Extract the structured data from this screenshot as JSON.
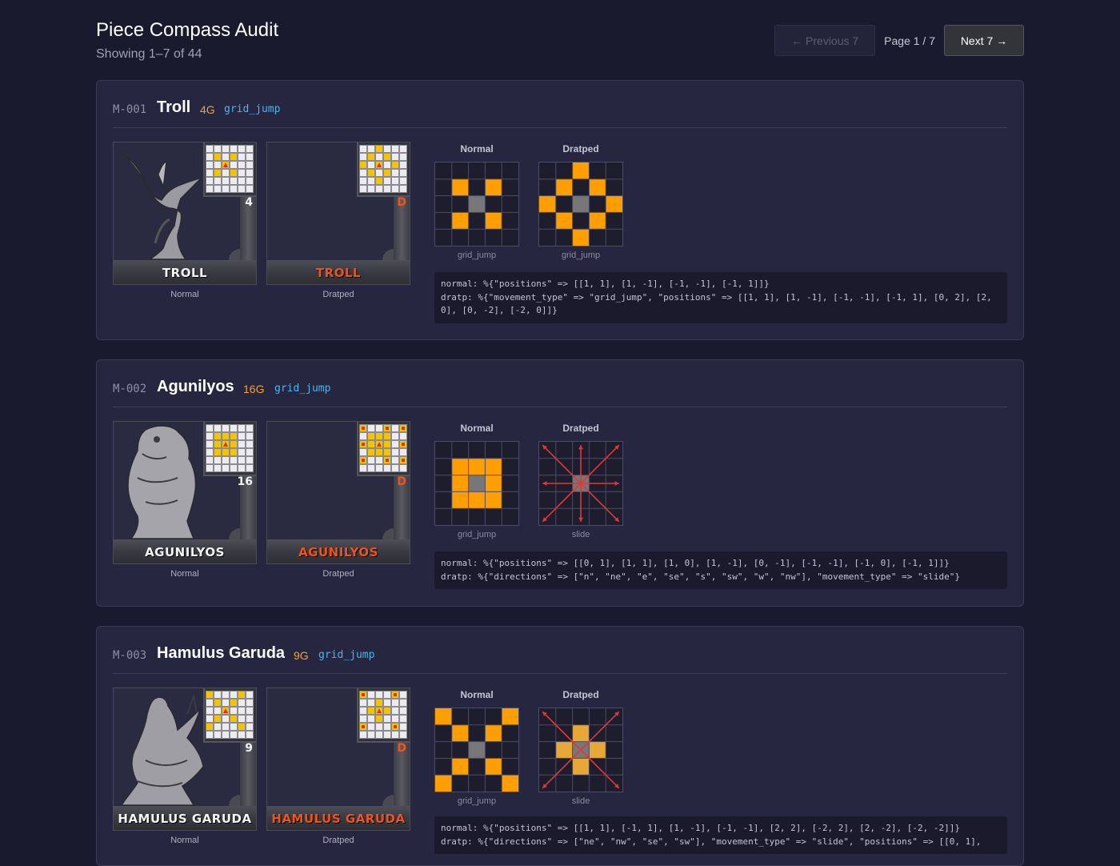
{
  "header": {
    "title": "Piece Compass Audit",
    "subtitle": "Showing 1–7 of 44",
    "prev_label": "← Previous 7",
    "page_indicator": "Page 1 / 7",
    "next_label": "Next 7 →"
  },
  "labels": {
    "normal": "Normal",
    "dratped": "Dratped",
    "d_mark": "D"
  },
  "colors": {
    "background": "#1a1a2e",
    "card": "#262640",
    "move_orange": "#ff9e00",
    "center_gray": "#777777",
    "slide_red": "#e03838",
    "cost_orange": "#f7a325",
    "type_blue": "#42b8f0",
    "tile_name_orange": "#f0541c"
  },
  "pieces": [
    {
      "id": "M-001",
      "name": "Troll",
      "cost": "4G",
      "movement_type": "grid_jump",
      "tile_name": "TROLL",
      "tile_cost": "4",
      "normal_grid": {
        "label": "grid_jump",
        "positions": [
          [
            1,
            1
          ],
          [
            1,
            -1
          ],
          [
            -1,
            -1
          ],
          [
            -1,
            1
          ]
        ]
      },
      "dratped_grid": {
        "label": "grid_jump",
        "positions": [
          [
            1,
            1
          ],
          [
            1,
            -1
          ],
          [
            -1,
            -1
          ],
          [
            -1,
            1
          ],
          [
            0,
            2
          ],
          [
            2,
            0
          ],
          [
            0,
            -2
          ],
          [
            -2,
            0
          ]
        ]
      },
      "code_normal": "normal: %{\"positions\" => [[1, 1], [1, -1], [-1, -1], [-1, 1]]}",
      "code_dratp": "dratp: %{\"movement_type\" => \"grid_jump\", \"positions\" => [[1, 1], [1, -1], [-1, -1], [-1, 1], [0, 2], [2, 0], [0, -2], [-2, 0]]}"
    },
    {
      "id": "M-002",
      "name": "Agunilyos",
      "cost": "16G",
      "movement_type": "grid_jump",
      "tile_name": "AGUNILYOS",
      "tile_cost": "16",
      "normal_grid": {
        "label": "grid_jump",
        "positions": [
          [
            0,
            1
          ],
          [
            1,
            1
          ],
          [
            1,
            0
          ],
          [
            1,
            -1
          ],
          [
            0,
            -1
          ],
          [
            -1,
            -1
          ],
          [
            -1,
            0
          ],
          [
            -1,
            1
          ]
        ]
      },
      "dratped_grid": {
        "label": "slide",
        "directions": [
          "n",
          "ne",
          "e",
          "se",
          "s",
          "sw",
          "w",
          "nw"
        ]
      },
      "code_normal": "normal: %{\"positions\" => [[0, 1], [1, 1], [1, 0], [1, -1], [0, -1], [-1, -1], [-1, 0], [-1, 1]]}",
      "code_dratp": "dratp: %{\"directions\" => [\"n\", \"ne\", \"e\", \"se\", \"s\", \"sw\", \"w\", \"nw\"], \"movement_type\" => \"slide\"}"
    },
    {
      "id": "M-003",
      "name": "Hamulus Garuda",
      "cost": "9G",
      "movement_type": "grid_jump",
      "tile_name": "HAMULUS GARUDA",
      "tile_cost": "9",
      "normal_grid": {
        "label": "grid_jump",
        "positions": [
          [
            1,
            1
          ],
          [
            -1,
            1
          ],
          [
            1,
            -1
          ],
          [
            -1,
            -1
          ],
          [
            2,
            2
          ],
          [
            -2,
            2
          ],
          [
            2,
            -2
          ],
          [
            -2,
            -2
          ]
        ]
      },
      "dratped_grid": {
        "label": "slide",
        "directions": [
          "ne",
          "nw",
          "se",
          "sw"
        ],
        "positions": [
          [
            0,
            1
          ],
          [
            1,
            0
          ],
          [
            0,
            -1
          ],
          [
            -1,
            0
          ]
        ]
      },
      "code_normal": "normal: %{\"positions\" => [[1, 1], [-1, 1], [1, -1], [-1, -1], [2, 2], [-2, 2], [2, -2], [-2, -2]]}",
      "code_dratp": "dratp: %{\"directions\" => [\"ne\", \"nw\", \"se\", \"sw\"], \"movement_type\" => \"slide\", \"positions\" => [[0, 1],"
    }
  ]
}
